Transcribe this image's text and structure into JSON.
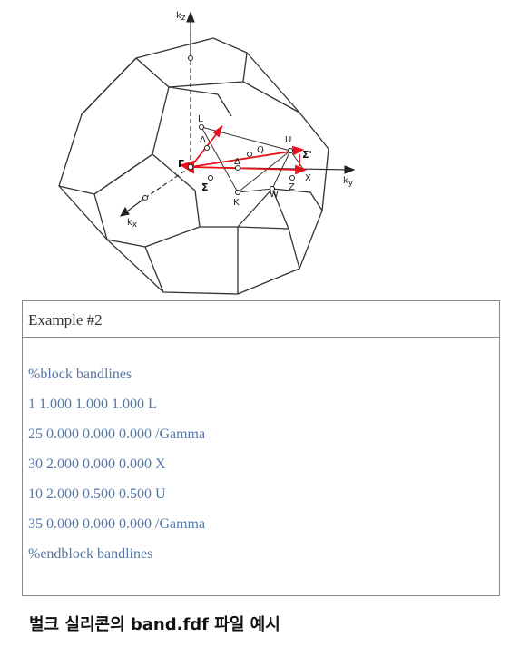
{
  "figure": {
    "axis_labels": {
      "kz": "k",
      "kz_sub": "z",
      "ky": "k",
      "ky_sub": "y",
      "kx": "k",
      "kx_sub": "x"
    },
    "points": {
      "L": "L",
      "Lambda": "Λ",
      "Gamma": "Γ",
      "Delta": "Δ",
      "Q": "Q",
      "U": "U",
      "SigmaPrime": "Σ'",
      "X": "X",
      "Sigma": "Σ",
      "K": "K",
      "W": "W",
      "Z": "Z"
    },
    "path_color": "#e8101a"
  },
  "example": {
    "title": "Example #2",
    "lines": [
      "%block bandlines",
      "1 1.000 1.000 1.000 L",
      "25 0.000 0.000 0.000 /Gamma",
      "30 2.000 0.000 0.000 X",
      "10 2.000 0.500 0.500 U",
      "35 0.000 0.000 0.000 /Gamma",
      "%endblock bandlines"
    ],
    "text_color": "#5577a8"
  },
  "caption": "벌크 실리콘의 band.fdf 파일 예시"
}
